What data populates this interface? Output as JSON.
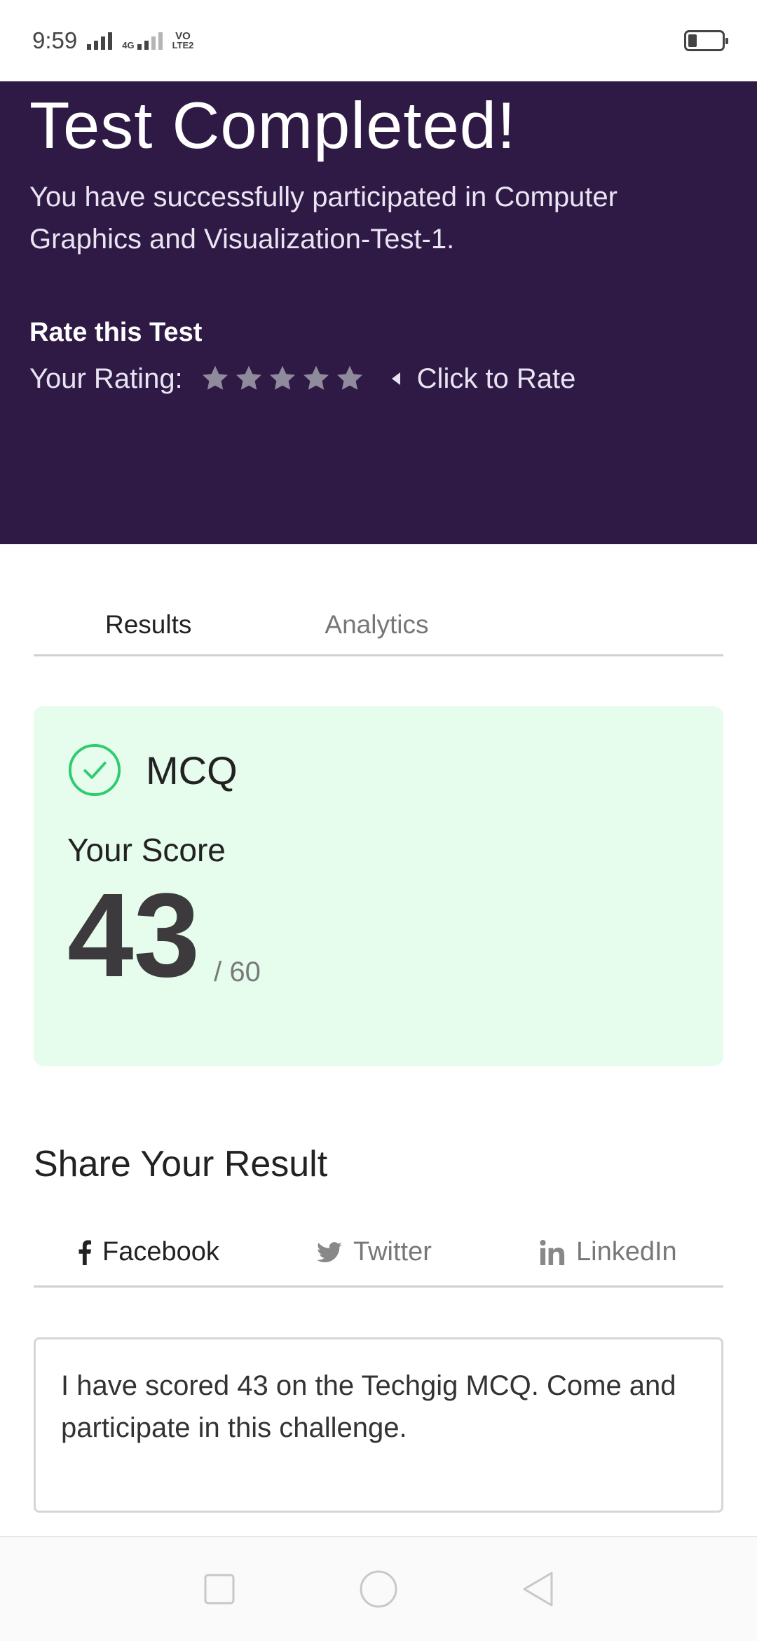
{
  "status_bar": {
    "time": "9:59",
    "network_label": "4G",
    "volte_label_top": "VO",
    "volte_label_bottom": "LTE2"
  },
  "hero": {
    "title": "Test Completed!",
    "description": "You have successfully participated in Computer Graphics and Visualization-Test-1.",
    "rate_heading": "Rate this Test",
    "rating_label": "Your Rating:",
    "rating_value": 0,
    "rating_max": 5,
    "rate_link": "Click to Rate"
  },
  "tabs": {
    "results": "Results",
    "analytics": "Analytics",
    "active": "results"
  },
  "score_card": {
    "section": "MCQ",
    "label": "Your Score",
    "score": "43",
    "total": "/ 60"
  },
  "share": {
    "title": "Share Your Result",
    "tabs": {
      "facebook": "Facebook",
      "twitter": "Twitter",
      "linkedin": "LinkedIn"
    },
    "active": "facebook",
    "message": "I have scored 43 on the Techgig MCQ. Come and participate in this challenge."
  },
  "colors": {
    "hero_bg": "#2f1a46",
    "card_bg": "#e6fcec",
    "check_green": "#2ecc71",
    "star_inactive": "#8f8a9c"
  },
  "icons": {
    "check": "check-circle-icon",
    "star": "star-icon",
    "facebook": "facebook-icon",
    "twitter": "twitter-icon",
    "linkedin": "linkedin-icon"
  }
}
